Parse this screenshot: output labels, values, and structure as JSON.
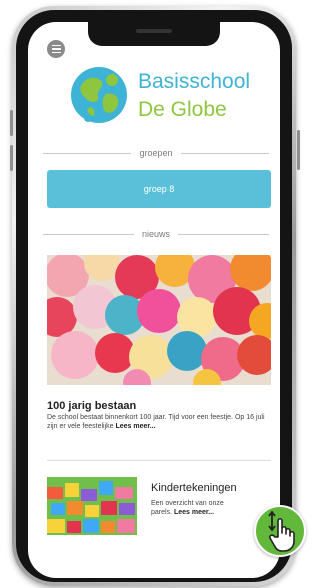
{
  "app": {
    "logo_line1": "Basisschool",
    "logo_line2": "De Globe",
    "brand_colors": {
      "blue": "#3fb3d5",
      "green": "#8ec63f",
      "button": "#5ac0da",
      "badge": "#62b83a"
    }
  },
  "icons": {
    "menu": "hamburger-icon",
    "logo": "globe-logo-icon",
    "scroll": "hand-scroll-icon"
  },
  "sections": {
    "groups_label": "groepen",
    "news_label": "nieuws"
  },
  "groups": {
    "button_label": "groep 8"
  },
  "news": [
    {
      "title": "100 jarig bestaan",
      "text": "De school bestaat binnenkort 100 jaar. Tijd voor een feestje. Op 16 juli zijn er vele feestelijke",
      "read_more": "Lees meer..."
    },
    {
      "title": "Kindertekeningen",
      "text": "Een overzicht van onze parels.",
      "read_more": "Lees meer..."
    }
  ]
}
